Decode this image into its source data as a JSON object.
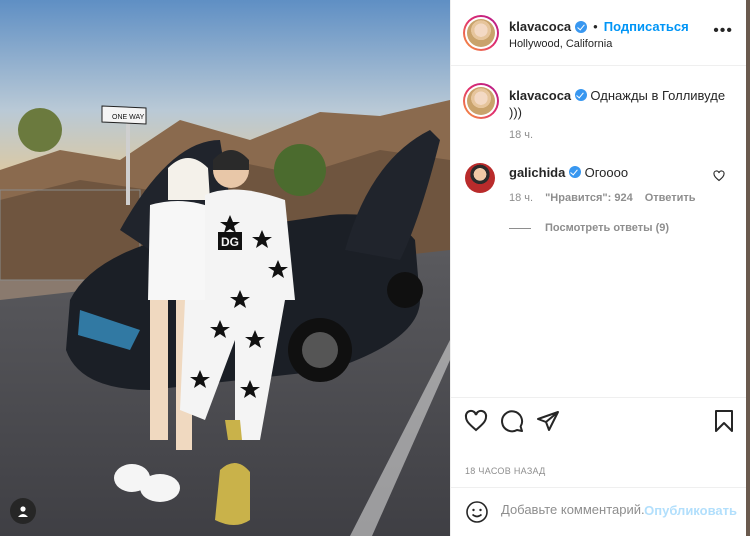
{
  "post": {
    "author": "klavacoca",
    "follow_label": "Подписаться",
    "location": "Hollywood, California",
    "more_glyph": "•••",
    "caption_text": "Однажды в Голливуде )))",
    "caption_time": "18 ч.",
    "time_ago": "18 ЧАСОВ НАЗАД"
  },
  "photo": {
    "sign_text": "ONE WAY"
  },
  "comments": [
    {
      "user": "galichida",
      "text": "Огоооо",
      "time": "18 ч.",
      "likes_label": "\"Нравится\": 924",
      "reply_label": "Ответить",
      "replies_label": "Посмотреть ответы (9)"
    }
  ],
  "add_comment": {
    "placeholder": "Добавьте комментарий...",
    "publish_label": "Опубликовать"
  },
  "colors": {
    "verified": "#3897f0",
    "follow": "#0095f6",
    "publish_disabled": "#b2dffc"
  },
  "icons": [
    "user-tag-icon",
    "verified-badge-icon",
    "more-options-icon",
    "heart-icon",
    "comment-icon",
    "share-icon",
    "bookmark-icon",
    "emoji-icon"
  ]
}
